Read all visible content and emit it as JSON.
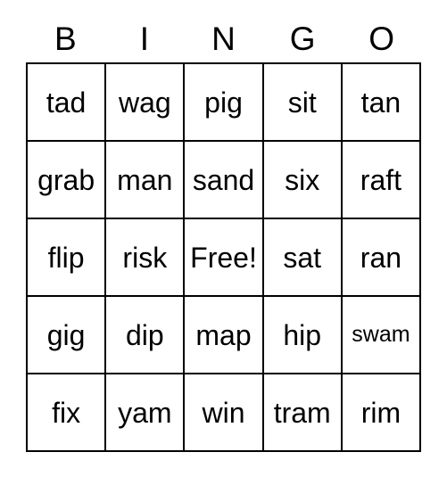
{
  "card": {
    "title": "BINGO",
    "headers": [
      "B",
      "I",
      "N",
      "G",
      "O"
    ],
    "free_space_label": "Free!",
    "colors": {
      "border": "#000000",
      "background": "#ffffff",
      "text": "#000000"
    },
    "rows": [
      [
        {
          "label": "tad",
          "shrink": false
        },
        {
          "label": "wag",
          "shrink": false
        },
        {
          "label": "pig",
          "shrink": false
        },
        {
          "label": "sit",
          "shrink": false
        },
        {
          "label": "tan",
          "shrink": false
        }
      ],
      [
        {
          "label": "grab",
          "shrink": false
        },
        {
          "label": "man",
          "shrink": false
        },
        {
          "label": "sand",
          "shrink": false
        },
        {
          "label": "six",
          "shrink": false
        },
        {
          "label": "raft",
          "shrink": false
        }
      ],
      [
        {
          "label": "flip",
          "shrink": false
        },
        {
          "label": "risk",
          "shrink": false
        },
        {
          "label": "Free!",
          "shrink": false
        },
        {
          "label": "sat",
          "shrink": false
        },
        {
          "label": "ran",
          "shrink": false
        }
      ],
      [
        {
          "label": "gig",
          "shrink": false
        },
        {
          "label": "dip",
          "shrink": false
        },
        {
          "label": "map",
          "shrink": false
        },
        {
          "label": "hip",
          "shrink": false
        },
        {
          "label": "swam",
          "shrink": true
        }
      ],
      [
        {
          "label": "fix",
          "shrink": false
        },
        {
          "label": "yam",
          "shrink": false
        },
        {
          "label": "win",
          "shrink": false
        },
        {
          "label": "tram",
          "shrink": false
        },
        {
          "label": "rim",
          "shrink": false
        }
      ]
    ]
  }
}
